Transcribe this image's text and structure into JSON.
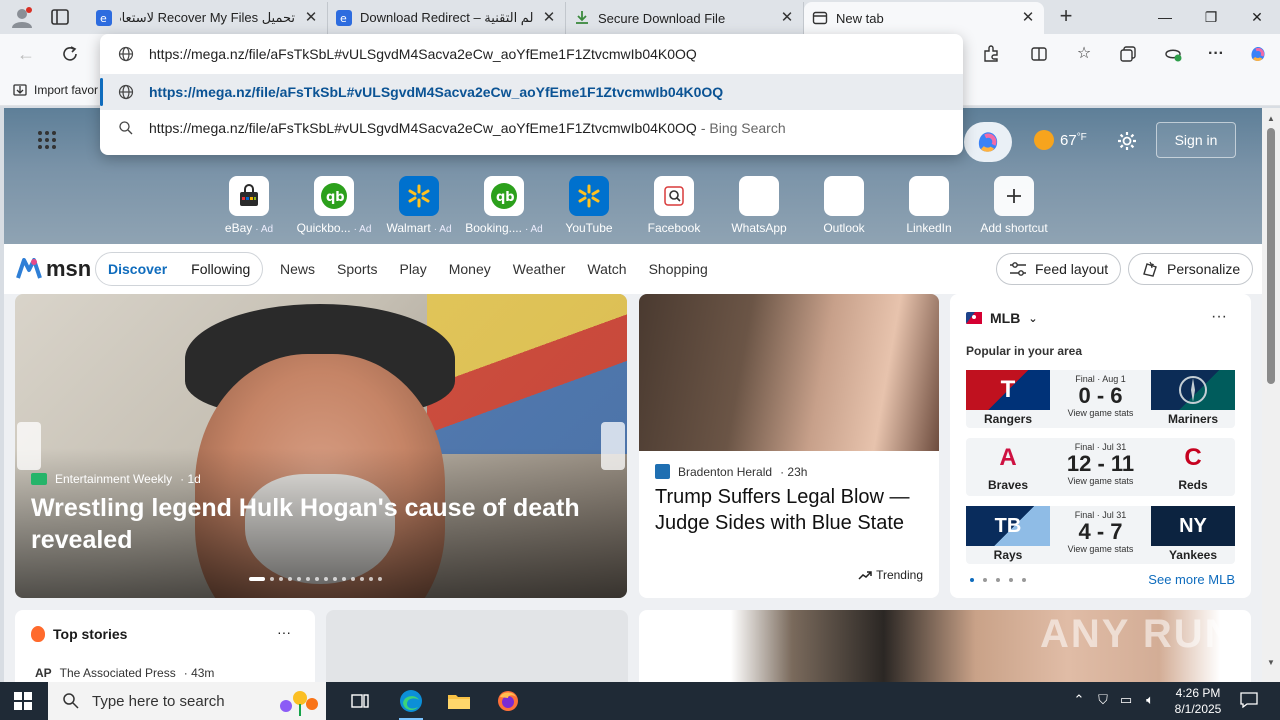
{
  "tabs": [
    {
      "title": "تحميل Recover My Files لاستعادة الـ",
      "active": false
    },
    {
      "title": "Download Redirect – عالم التقنية",
      "active": false
    },
    {
      "title": "Secure Download File",
      "active": false
    },
    {
      "title": "New tab",
      "active": true
    }
  ],
  "omnibox": {
    "input": "https://mega.nz/file/aFsTkSbL#vULSgvdM4Sacva2eCw_aoYfEme1F1ZtvcmwIb04K0OQ",
    "suggestion_url": "https://mega.nz/file/aFsTkSbL#vULSgvdM4Sacva2eCw_aoYfEme1F1ZtvcmwIb04K0OQ",
    "suggestion_search": "https://mega.nz/file/aFsTkSbL#vULSgvdM4Sacva2eCw_aoYfEme1F1ZtvcmwIb04K0OQ",
    "search_suffix": "- Bing Search"
  },
  "favbar": {
    "import_label": "Import favor"
  },
  "weather": {
    "temp": "67",
    "unit": "°F"
  },
  "signin": "Sign in",
  "shortcuts": [
    {
      "label": "eBay",
      "ad": "· Ad"
    },
    {
      "label": "Quickbo...",
      "ad": "· Ad"
    },
    {
      "label": "Walmart",
      "ad": "· Ad"
    },
    {
      "label": "Booking....",
      "ad": "· Ad"
    },
    {
      "label": "YouTube",
      "ad": ""
    },
    {
      "label": "Facebook",
      "ad": ""
    },
    {
      "label": "WhatsApp",
      "ad": ""
    },
    {
      "label": "Outlook",
      "ad": ""
    },
    {
      "label": "LinkedIn",
      "ad": ""
    },
    {
      "label": "Add shortcut",
      "ad": ""
    }
  ],
  "msn": {
    "logo": "msn",
    "discover": "Discover",
    "following": "Following",
    "links": [
      "News",
      "Sports",
      "Play",
      "Money",
      "Weather",
      "Watch",
      "Shopping"
    ],
    "feed_layout": "Feed layout",
    "personalize": "Personalize"
  },
  "hero_story": {
    "source": "Entertainment Weekly",
    "age": "· 1d",
    "title": "Wrestling legend Hulk Hogan's cause of death revealed"
  },
  "mid_story": {
    "source": "Bradenton Herald",
    "age": "· 23h",
    "title": "Trump Suffers Legal Blow — Judge Sides with Blue State",
    "trending": "Trending"
  },
  "mlb": {
    "league": "MLB",
    "subtitle": "Popular in your area",
    "games": [
      {
        "status": "Final · Aug 1",
        "score": "0 - 6",
        "home": "Rangers",
        "away": "Mariners",
        "link": "View game stats"
      },
      {
        "status": "Final · Jul 31",
        "score": "12 - 11",
        "home": "Braves",
        "away": "Reds",
        "link": "View game stats"
      },
      {
        "status": "Final · Jul 31",
        "score": "4 - 7",
        "home": "Rays",
        "away": "Yankees",
        "link": "View game stats"
      }
    ],
    "see_more": "See more MLB"
  },
  "top_stories": {
    "title": "Top stories",
    "source": "The Associated Press",
    "source_logo": "AP",
    "age": "· 43m"
  },
  "watermark": "ANY RUN",
  "taskbar": {
    "search_placeholder": "Type here to search",
    "time": "4:26 PM",
    "date": "8/1/2025"
  }
}
